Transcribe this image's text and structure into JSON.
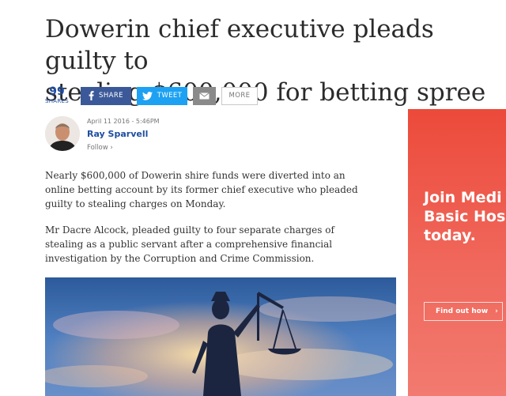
{
  "article": {
    "headline_line1": "Dowerin chief executive pleads guilty to",
    "headline_line2": "stealing $600,000 for betting spree",
    "paragraphs": [
      "Nearly $600,000 of Dowerin shire funds were diverted into an online betting account by its former chief executive who pleaded guilty to stealing charges on Monday.",
      "Mr Dacre Alcock, pleaded guilty to four separate charges of stealing as a public servant after a comprehensive financial investigation by the Corruption and Crime Commission."
    ]
  },
  "share": {
    "count": "99",
    "count_label": "SHARES",
    "facebook_label": "SHARE",
    "twitter_label": "TWEET",
    "more_label": "MORE",
    "icons": [
      "facebook-icon",
      "twitter-icon",
      "email-icon"
    ]
  },
  "byline": {
    "date": "April 11 2016 - 5:46PM",
    "author": "Ray Sparvell",
    "follow": "Follow"
  },
  "ad": {
    "line1": "Join Medi",
    "line2": "Basic Hos",
    "line3": "today.",
    "cta": "Find out how"
  },
  "colors": {
    "brand_blue": "#1f4ea1",
    "facebook": "#3b5998",
    "twitter": "#1da1f2",
    "ad_red": "#ec4a3a"
  }
}
